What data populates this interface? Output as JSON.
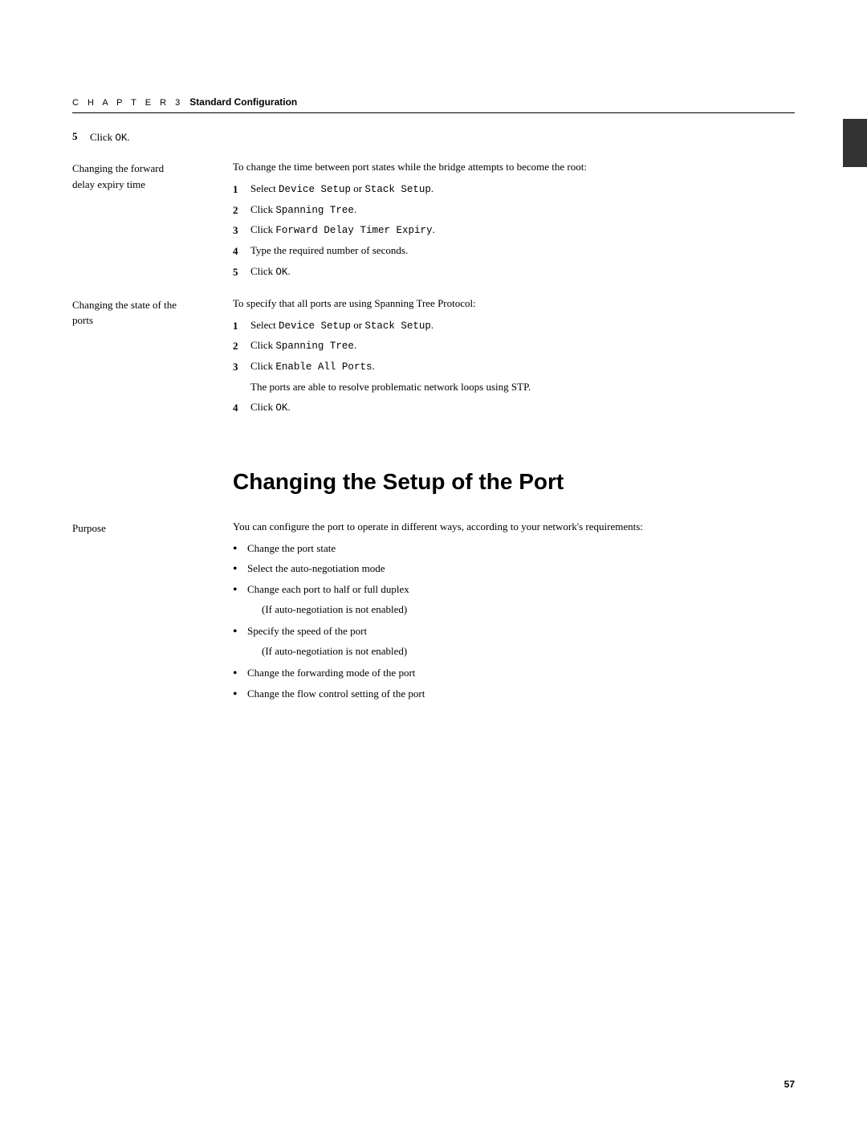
{
  "page": {
    "number": "57"
  },
  "chapter": {
    "label": "C H A P T E R  3",
    "title": "Standard Configuration"
  },
  "intro_step": {
    "number": "5",
    "text_prefix": "Click ",
    "text_code": "OK",
    "text_suffix": "."
  },
  "section1": {
    "label_line1": "Changing the forward",
    "label_line2": "delay expiry time",
    "intro": "To change the time between port states while the bridge attempts to become the root:",
    "steps": [
      {
        "num": "1",
        "prefix": "Select ",
        "code1": "Device Setup",
        "middle": " or ",
        "code2": "Stack Setup",
        "suffix": "."
      },
      {
        "num": "2",
        "prefix": "Click ",
        "code": "Spanning Tree",
        "suffix": "."
      },
      {
        "num": "3",
        "prefix": "Click ",
        "code": "Forward Delay Timer Expiry",
        "suffix": "."
      },
      {
        "num": "4",
        "text": "Type the required number of seconds."
      },
      {
        "num": "5",
        "prefix": "Click ",
        "code": "OK",
        "suffix": "."
      }
    ]
  },
  "section2": {
    "label_line1": "Changing the state of the",
    "label_line2": "ports",
    "intro": "To specify that all ports are using Spanning Tree Protocol:",
    "steps": [
      {
        "num": "1",
        "prefix": "Select ",
        "code1": "Device Setup",
        "middle": " or ",
        "code2": "Stack Setup",
        "suffix": "."
      },
      {
        "num": "2",
        "prefix": "Click ",
        "code": "Spanning Tree",
        "suffix": "."
      },
      {
        "num": "3",
        "prefix": "Click ",
        "code": "Enable All Ports",
        "suffix": ".",
        "sub": "The ports are able to resolve problematic network loops using STP."
      },
      {
        "num": "4",
        "prefix": "Click ",
        "code": "OK",
        "suffix": "."
      }
    ]
  },
  "main_heading": "Changing the Setup of the Port",
  "purpose_section": {
    "label": "Purpose",
    "intro": "You can configure the port to operate in different ways, according to your network's requirements:",
    "bullets": [
      "Change the port state",
      "Select the auto-negotiation mode",
      "Change each port to half or full duplex",
      "(If auto-negotiation is not enabled)",
      "Specify the speed of the port",
      "(If auto-negotiation is not enabled)",
      "Change the forwarding mode of the port",
      "Change the flow control setting of the port"
    ],
    "bullet_subs": [
      3,
      5
    ]
  }
}
